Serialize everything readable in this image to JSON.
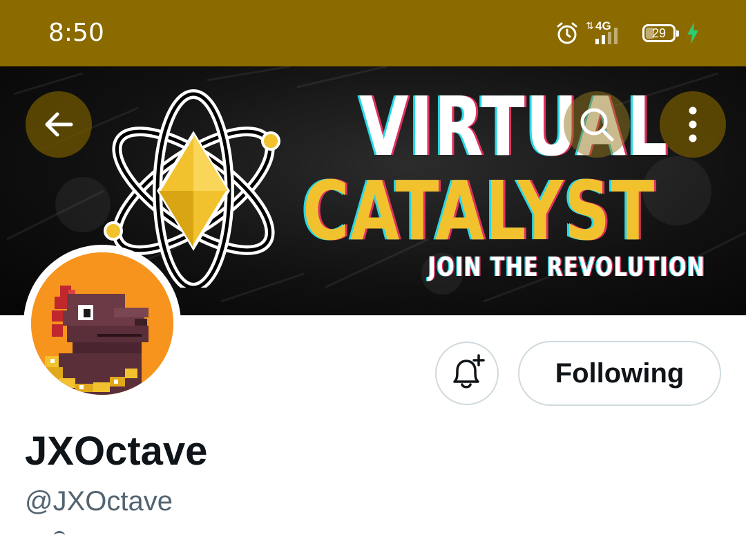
{
  "status_bar": {
    "time": "8:50",
    "network_label": "4G",
    "battery_level": "29",
    "icons": [
      "alarm-icon",
      "network-4g-icon",
      "signal-icon",
      "battery-icon",
      "charging-bolt-icon"
    ]
  },
  "banner": {
    "title_line1": "VIRTUAL",
    "title_line2": "CATALYST",
    "tagline": "JOIN THE REVOLUTION",
    "colors": {
      "accent_yellow": "#f2c12e",
      "cyan_shadow": "#27d8e6",
      "red_shadow": "#e0315f"
    }
  },
  "nav": {
    "back_icon": "arrow-left-icon",
    "search_icon": "search-icon",
    "more_icon": "more-vertical-icon"
  },
  "profile": {
    "display_name": "JXOctave",
    "handle": "@JXOctave",
    "follow_button_label": "Following",
    "notify_icon": "bell-plus-icon",
    "avatar_background": "#f7941d"
  },
  "theme": {
    "status_bar_color": "#8b6a00",
    "text_primary": "#0f1419",
    "text_secondary": "#536471",
    "border": "#cfd9de"
  }
}
